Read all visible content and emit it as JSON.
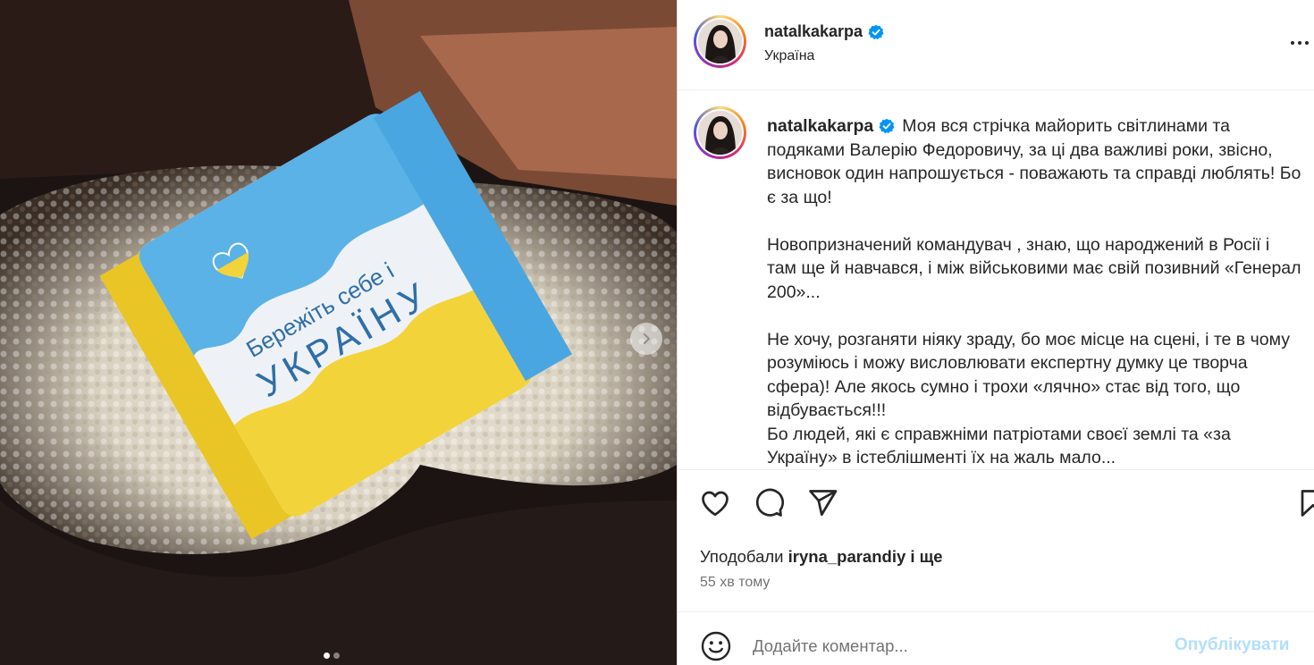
{
  "post": {
    "username": "natalkakarpa",
    "location": "Україна",
    "verified": true,
    "caption": "Моя вся стрічка майорить світлинами та подяками Валерію Федоровичу, за ці два важливі роки, звісно, висновок один напрошується - поважають та справді люблять! Бо є за що!\n\nНовопризначений командувач , знаю, що народжений в Росії і там ще й навчався, і між військовими має свій позивний «Генерал 200»...\n\nНе хочу, розганяти ніяку зраду, бо моє місце на сцені, і те в чому розуміюсь і можу висловлювати експертну думку це творча сфера)! Але якось сумно і трохи «лячно» стає від того, що відбувається!!!\nБо людей, які є справжніми патріотами своєї землі та «за Україну» в істеблішменті їх на жаль мало...",
    "likes_prefix": "Уподобали",
    "likes_user": "iryna_parandiy",
    "likes_suffix": "і ще",
    "time_ago": "55 хв тому"
  },
  "media": {
    "candy_text_line1": "Бережіть себе і",
    "candy_text_line2": "УКРАЇНУ",
    "carousel_count": 2,
    "carousel_active": 1
  },
  "comment": {
    "placeholder": "Додайте коментар...",
    "publish_label": "Опублікувати"
  },
  "icons": {
    "like": "heart-icon",
    "comment": "comment-icon",
    "share": "share-icon",
    "save": "bookmark-icon",
    "more": "more-icon",
    "emoji": "emoji-icon",
    "next": "chevron-right-icon"
  },
  "colors": {
    "verified": "#0095f6",
    "publish": "#b2dffc",
    "candy_blue": "#5ab2e6",
    "candy_yellow": "#f3d33a"
  }
}
